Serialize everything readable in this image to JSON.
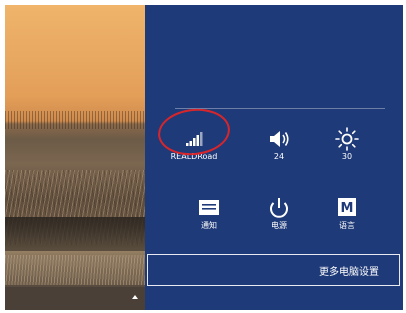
{
  "settings_panel": {
    "quick_settings": [
      {
        "id": "network",
        "label": "REALDRoad",
        "icon": "wifi-signal-icon"
      },
      {
        "id": "volume",
        "label": "24",
        "icon": "speaker-volume-icon"
      },
      {
        "id": "brightness",
        "label": "30",
        "icon": "brightness-sun-icon"
      },
      {
        "id": "notifications",
        "label": "通知",
        "icon": "notification-icon"
      },
      {
        "id": "power",
        "label": "电源",
        "icon": "power-icon"
      },
      {
        "id": "keyboard",
        "label": "语言",
        "icon": "keyboard-language-icon",
        "glyph": "M"
      }
    ],
    "more_settings_label": "更多电脑设置"
  },
  "annotation": {
    "network_highlight_color": "#d7262b"
  },
  "colors": {
    "panel_background": "#1f3a78",
    "text": "#ffffff"
  }
}
